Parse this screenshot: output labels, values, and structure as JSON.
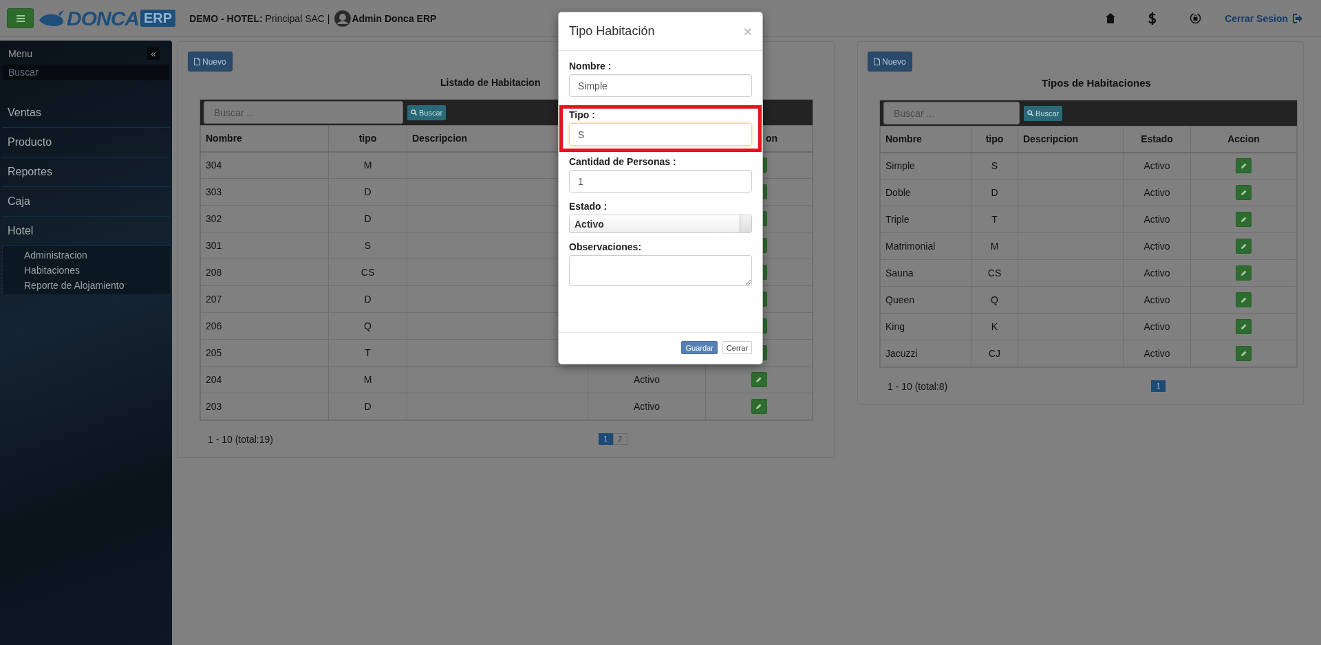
{
  "header": {
    "logo": {
      "name": "DONCA",
      "badge": "ERP"
    },
    "company": "**DEMO - HOTEL:** Principal SAC |",
    "user": "Admin Donca ERP",
    "logout": "Cerrar Sesion"
  },
  "sidebar": {
    "title": "Menu",
    "collapse": "«",
    "search": {
      "placeholder": "Buscar"
    },
    "items": [
      {
        "label": "Ventas"
      },
      {
        "label": "Producto"
      },
      {
        "label": "Reportes"
      },
      {
        "label": "Caja"
      },
      {
        "label": "Hotel",
        "children": [
          {
            "label": "Administracion"
          },
          {
            "label": "Habitaciones"
          },
          {
            "label": "Reporte de Alojamiento"
          }
        ]
      }
    ]
  },
  "panels": [
    {
      "new_button": "Nuevo",
      "title": "Listado de Habitacion",
      "search": {
        "placeholder": "Buscar ...",
        "button": "Buscar"
      },
      "columns": [
        {
          "label": "Nombre"
        },
        {
          "label": "tipo"
        },
        {
          "label": "Descripcion"
        },
        {},
        {
          "label": "on"
        }
      ],
      "rows": [
        {
          "cells": [
            "304",
            "M",
            null,
            null
          ]
        },
        {
          "cells": [
            "303",
            "D",
            null,
            null
          ]
        },
        {
          "cells": [
            "302",
            "D",
            null,
            null
          ]
        },
        {
          "cells": [
            "301",
            "S",
            null,
            null
          ]
        },
        {
          "cells": [
            "208",
            "CS",
            null,
            null
          ]
        },
        {
          "cells": [
            "207",
            "D",
            null,
            null
          ]
        },
        {
          "cells": [
            "206",
            "Q",
            null,
            null
          ]
        },
        {
          "cells": [
            "205",
            "T",
            null,
            null
          ]
        },
        {
          "cells": [
            "204",
            "M",
            null,
            "Activo"
          ]
        },
        {
          "cells": [
            "203",
            "D",
            null,
            "Activo"
          ]
        }
      ],
      "summary": "1 - 10 (total:19)",
      "pages": [
        {
          "label": "1",
          "selected": true
        },
        {
          "label": "2",
          "selected": false
        }
      ]
    },
    {
      "new_button": "Nuevo",
      "title": "Tipos de Habitaciones",
      "search": {
        "placeholder": "Buscar ...",
        "button": "Buscar"
      },
      "columns": [
        {
          "label": "Nombre"
        },
        {
          "label": "tipo"
        },
        {
          "label": "Descripcion"
        },
        {
          "label": "Estado"
        },
        {
          "label": "Accion"
        }
      ],
      "rows": [
        {
          "cells": [
            "Simple",
            "S",
            null,
            "Activo"
          ]
        },
        {
          "cells": [
            "Doble",
            "D",
            null,
            "Activo"
          ]
        },
        {
          "cells": [
            "Triple",
            "T",
            null,
            "Activo"
          ]
        },
        {
          "cells": [
            "Matrimonial",
            "M",
            null,
            "Activo"
          ]
        },
        {
          "cells": [
            "Sauna",
            "CS",
            null,
            "Activo"
          ]
        },
        {
          "cells": [
            "Queen",
            "Q",
            null,
            "Activo"
          ]
        },
        {
          "cells": [
            "King",
            "K",
            null,
            "Activo"
          ]
        },
        {
          "cells": [
            "Jacuzzi",
            "CJ",
            null,
            "Activo"
          ]
        }
      ],
      "summary": "1 - 10 (total:8)",
      "pages": [
        {
          "label": "1",
          "selected": true
        }
      ]
    }
  ],
  "modal": {
    "title": "Tipo Habitación",
    "close": "×",
    "fields": [
      {
        "kind": "text",
        "label": "Nombre :",
        "value": "Simple",
        "focused": false,
        "highlighted": false
      },
      {
        "kind": "text",
        "label": "Tipo :",
        "value": "S",
        "focused": true,
        "highlighted": true
      },
      {
        "kind": "text",
        "label": "Cantidad de Personas :",
        "value": "1",
        "focused": false,
        "highlighted": false
      },
      {
        "kind": "select",
        "label": "Estado :",
        "value": "Activo",
        "focused": false,
        "highlighted": false
      },
      {
        "kind": "textarea",
        "label": "Observaciones:",
        "focused": false,
        "highlighted": false
      }
    ],
    "buttons": [
      {
        "label": "Guardar",
        "kind": "primary"
      },
      {
        "label": "Cerrar",
        "kind": "default"
      }
    ]
  }
}
